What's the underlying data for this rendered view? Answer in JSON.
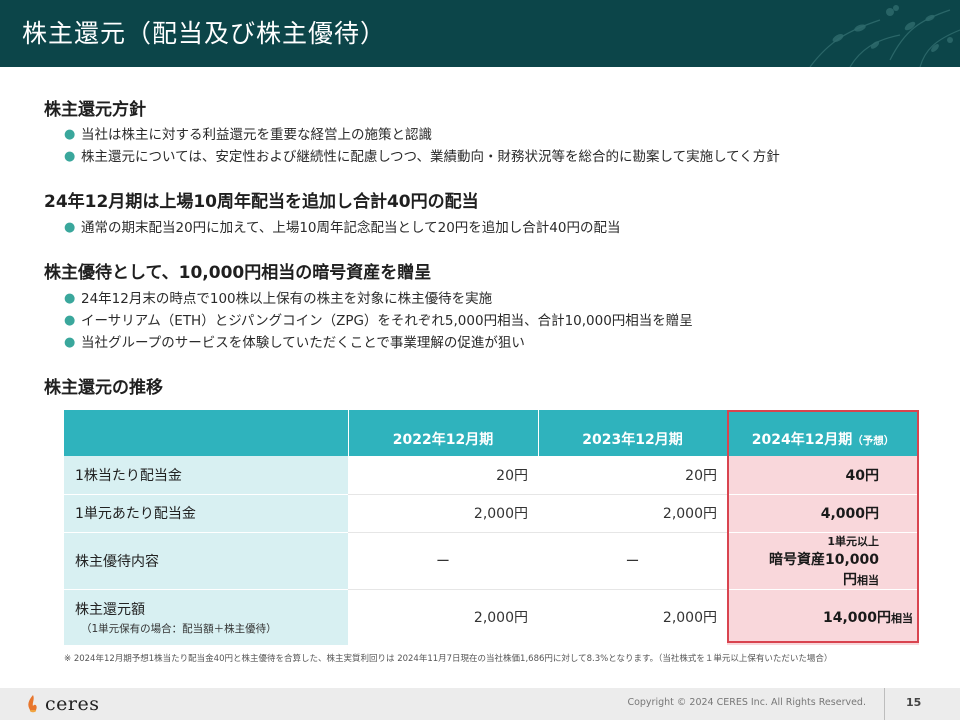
{
  "header": {
    "title": "株主還元（配当及び株主優待）"
  },
  "sections": [
    {
      "heading": "株主還元方針",
      "bullets": [
        "当社は株主に対する利益還元を重要な経営上の施策と認識",
        "株主還元については、安定性および継続性に配慮しつつ、業績動向・財務状況等を総合的に勘案して実施してく方針"
      ]
    },
    {
      "heading": "24年12月期は上場10周年配当を追加し合計40円の配当",
      "bullets": [
        "通常の期末配当20円に加えて、上場10周年記念配当として20円を追加し合計40円の配当"
      ]
    },
    {
      "heading": "株主優待として、10,000円相当の暗号資産を贈呈",
      "bullets": [
        "24年12月末の時点で100株以上保有の株主を対象に株主優待を実施",
        "イーサリアム（ETH）とジパングコイン（ZPG）をそれぞれ5,000円相当、合計10,000円相当を贈呈",
        "当社グループのサービスを体験していただくことで事業理解の促進が狙い"
      ]
    },
    {
      "heading": "株主還元の推移"
    }
  ],
  "table": {
    "columns": [
      "",
      "2022年12月期",
      "2023年12月期",
      "2024年12月期",
      "（予想）"
    ],
    "rows": [
      {
        "label": "1株当たり配当金",
        "v2022": "20円",
        "v2023": "20円",
        "v2024": "40円"
      },
      {
        "label": "1単元あたり配当金",
        "v2022": "2,000円",
        "v2023": "2,000円",
        "v2024": "4,000円"
      },
      {
        "label": "株主優待内容",
        "v2022": "ー",
        "v2023": "ー",
        "v2024_line1": "1単元以上",
        "v2024_line2": "暗号資産10,000円",
        "v2024_suffix": "相当"
      },
      {
        "label": "株主還元額",
        "sublabel": "（1単元保有の場合：配当額＋株主優待）",
        "v2022": "2,000円",
        "v2023": "2,000円",
        "v2024": "14,000円",
        "v2024_suffix": "相当"
      }
    ]
  },
  "footnote": "※ 2024年12月期予想1株当たり配当金40円と株主優待を合算した、株主実質利回りは 2024年11月7日現在の当社株価1,686円に対して8.3%となります。（当社株式を１単元以上保有いただいた場合）",
  "footer": {
    "logo_text": "ceres",
    "copyright": "Copyright © 2024 CERES Inc. All Rights Reserved.",
    "page_number": "15"
  },
  "colors": {
    "header_bg": "#0c4549",
    "table_header_bg": "#2fb3bd",
    "label_bg": "#d8f0f2",
    "highlight_bg": "#f9d7db",
    "highlight_border": "#d9444f",
    "bullet": "#3aa79c"
  }
}
